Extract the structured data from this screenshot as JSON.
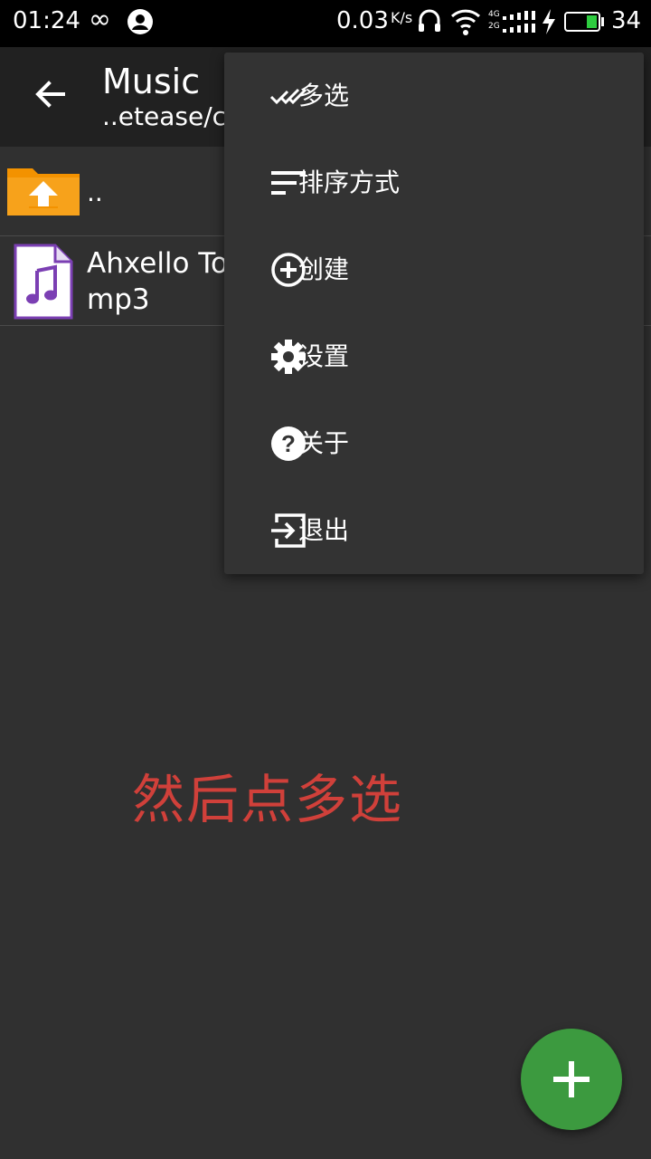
{
  "status_bar": {
    "time": "01:24",
    "speed": "0.03",
    "speed_unit": "K/s",
    "signal_top": "4G",
    "signal_bottom": "2G",
    "battery": "34"
  },
  "app_bar": {
    "title": "Music",
    "path": "..etease/c"
  },
  "file_list": [
    {
      "name": "..",
      "icon": "folder-up-icon"
    },
    {
      "name": "Ahxello To\nmp3",
      "icon": "audio-file-icon"
    }
  ],
  "overflow_menu": {
    "items": [
      {
        "label": "多选",
        "icon": "multi-select-check-icon"
      },
      {
        "label": "排序方式",
        "icon": "sort-icon"
      },
      {
        "label": "创建",
        "icon": "add-circle-icon"
      },
      {
        "label": "设置",
        "icon": "gear-icon"
      },
      {
        "label": "关于",
        "icon": "help-icon"
      },
      {
        "label": "退出",
        "icon": "exit-icon"
      }
    ]
  },
  "annotation": "然后点多选",
  "fab": {
    "icon": "plus-icon"
  },
  "colors": {
    "status_bar_bg": "#000000",
    "app_bar_bg": "#212121",
    "background": "#303030",
    "menu_bg": "#333333",
    "fab": "#3c9a3f",
    "annotation": "#d0403a",
    "folder_orange": "#f39200",
    "audio_purple": "#7b3fb3"
  }
}
